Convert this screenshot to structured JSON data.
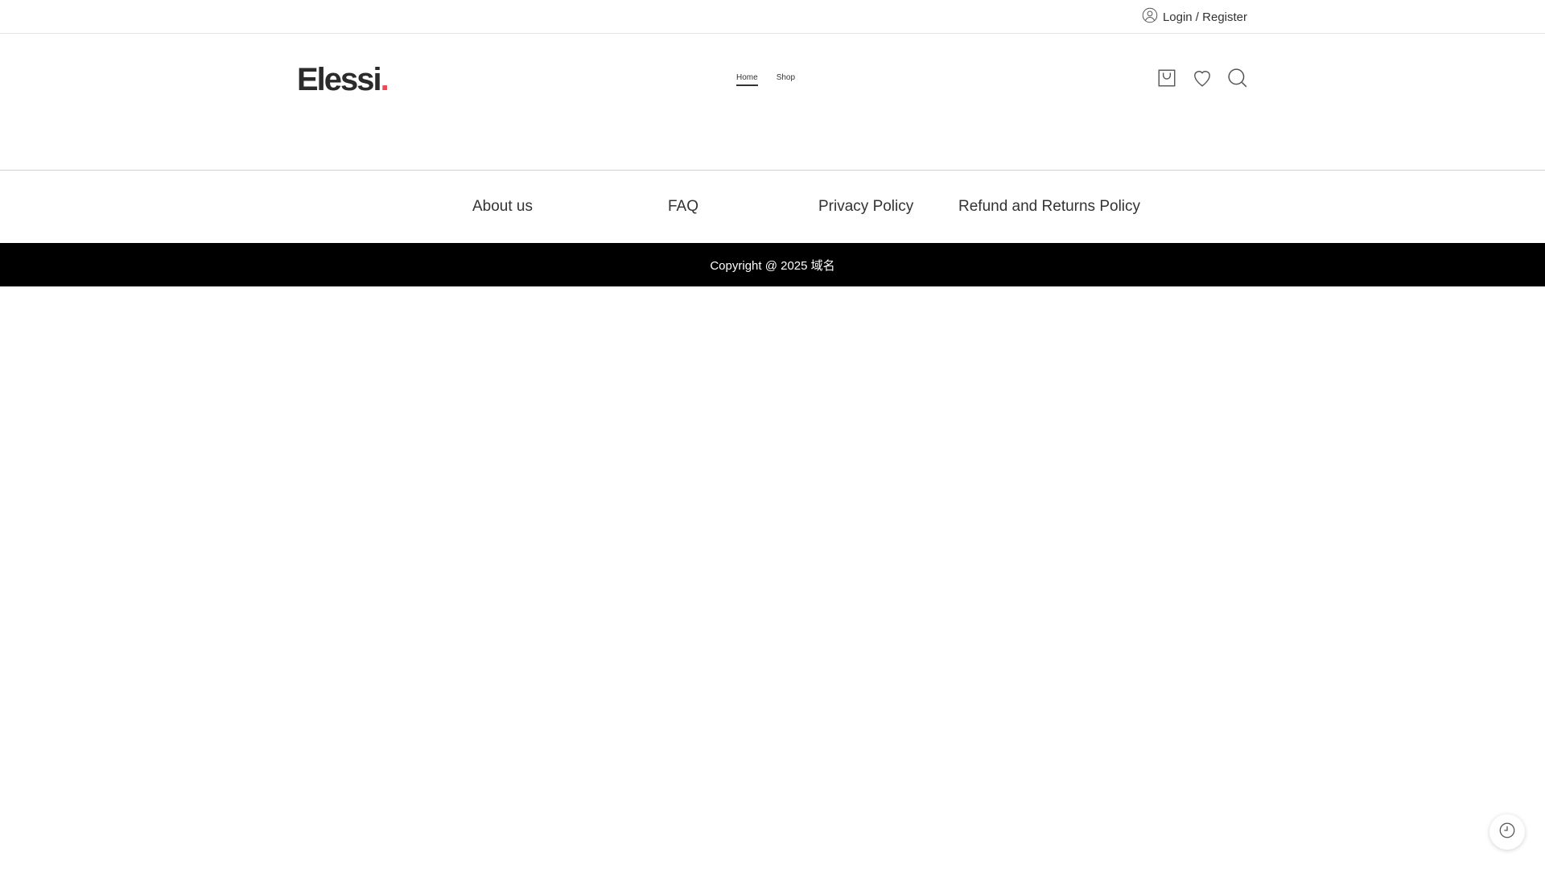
{
  "topbar": {
    "login_label": "Login / Register",
    "login_icon": "user-icon"
  },
  "header": {
    "logo_text": "Elessi",
    "logo_dot": ".",
    "logo_dot_color": "#e94b57",
    "nav": [
      {
        "label": "Home",
        "active": true
      },
      {
        "label": "Shop",
        "active": false
      }
    ],
    "icons": [
      "cart-icon",
      "heart-icon",
      "search-icon"
    ]
  },
  "footer": {
    "links": [
      "About us",
      "FAQ",
      "Privacy Policy",
      "Refund and Returns Policy"
    ],
    "copyright": "Copyright @ 2025 域名"
  },
  "floating": {
    "icon": "history-clock-icon"
  }
}
